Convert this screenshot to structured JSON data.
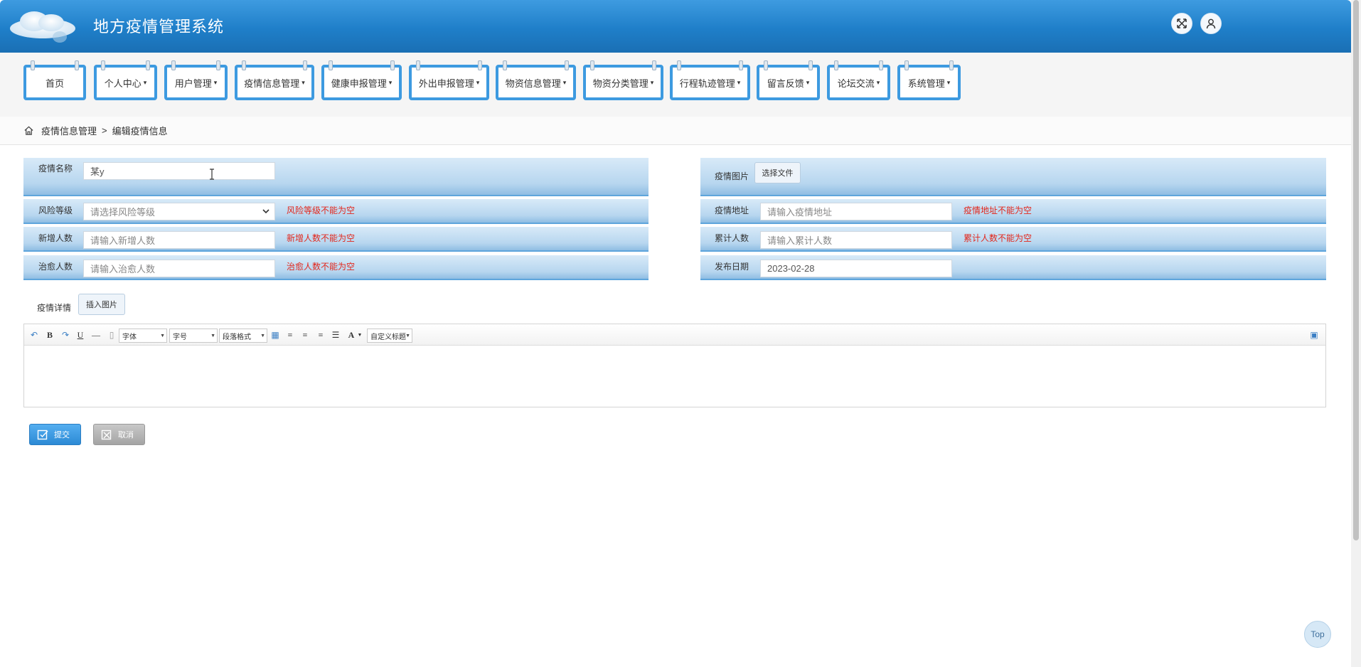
{
  "app": {
    "title": "地方疫情管理系统"
  },
  "nav": [
    {
      "label": "首页",
      "caret": ""
    },
    {
      "label": "个人中心",
      "caret": "▾"
    },
    {
      "label": "用户管理",
      "caret": "▾"
    },
    {
      "label": "疫情信息管理",
      "caret": "▾"
    },
    {
      "label": "健康申报管理",
      "caret": "▾"
    },
    {
      "label": "外出申报管理",
      "caret": "▾"
    },
    {
      "label": "物资信息管理",
      "caret": "▾"
    },
    {
      "label": "物资分类管理",
      "caret": "▾"
    },
    {
      "label": "行程轨迹管理",
      "caret": "▾"
    },
    {
      "label": "留言反馈",
      "caret": "▾"
    },
    {
      "label": "论坛交流",
      "caret": "▾"
    },
    {
      "label": "系统管理",
      "caret": "▾"
    }
  ],
  "breadcrumb": {
    "section": "疫情信息管理",
    "separator": ">",
    "page": "编辑疫情信息"
  },
  "form": {
    "name": {
      "label": "疫情名称",
      "value": "某y"
    },
    "image": {
      "label": "疫情图片",
      "button": "选择文件"
    },
    "risk": {
      "label": "风险等级",
      "placeholder": "请选择风险等级",
      "error": "风险等级不能为空"
    },
    "address": {
      "label": "疫情地址",
      "placeholder": "请输入疫情地址",
      "error": "疫情地址不能为空"
    },
    "new_cases": {
      "label": "新增人数",
      "placeholder": "请输入新增人数",
      "error": "新增人数不能为空"
    },
    "total": {
      "label": "累计人数",
      "placeholder": "请输入累计人数",
      "error": "累计人数不能为空"
    },
    "cured": {
      "label": "治愈人数",
      "placeholder": "请输入治愈人数",
      "error": "治愈人数不能为空"
    },
    "date": {
      "label": "发布日期",
      "value": "2023-02-28"
    },
    "detail": {
      "label": "疫情详情",
      "insert_image": "插入图片"
    }
  },
  "editor": {
    "bold": "B",
    "underline": "U",
    "font_color": "A",
    "font_family": "字体",
    "font_size": "字号",
    "paragraph": "段落格式",
    "custom_title": "自定义标题"
  },
  "actions": {
    "submit": "提交",
    "cancel": "取消"
  },
  "top_button": "Top",
  "colors": {
    "header": "#1f7fc9",
    "nav_border": "#3d9ae0",
    "error": "#e3271c",
    "row_band": "#b7d6ef"
  }
}
